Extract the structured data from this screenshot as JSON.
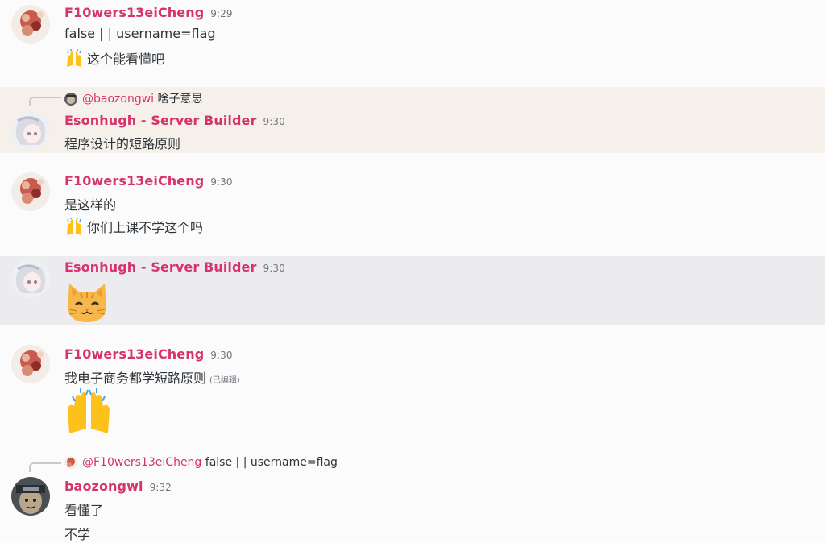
{
  "messages": [
    {
      "author": "F10wers13eiCheng",
      "time": "9:29",
      "lines": [
        "false | | username=flag",
        "这个能看懂吧"
      ]
    },
    {
      "reply": {
        "name": "@baozongwi",
        "text": "啥子意思"
      },
      "author": "Esonhugh - Server Builder",
      "time": "9:30",
      "lines": [
        "程序设计的短路原则"
      ]
    },
    {
      "author": "F10wers13eiCheng",
      "time": "9:30",
      "lines": [
        "是这样的",
        "你们上课不学这个吗"
      ]
    },
    {
      "author": "Esonhugh - Server Builder",
      "time": "9:30",
      "emoji": "cat-face"
    },
    {
      "author": "F10wers13eiCheng",
      "time": "9:30",
      "lines": [
        "我电子商务都学短路原则"
      ],
      "edited": "(已编辑)",
      "emoji": "raising-hands"
    },
    {
      "reply": {
        "name": "@F10wers13eiCheng",
        "text": "false | | username=flag"
      },
      "author": "baozongwi",
      "time": "9:32",
      "lines": [
        "看懂了",
        "不学"
      ]
    }
  ],
  "colors": {
    "author": "#d6336c",
    "highlight_reply": "#f5f1ea",
    "highlight_hover": "#ececef",
    "background": "#fbfbfb"
  }
}
